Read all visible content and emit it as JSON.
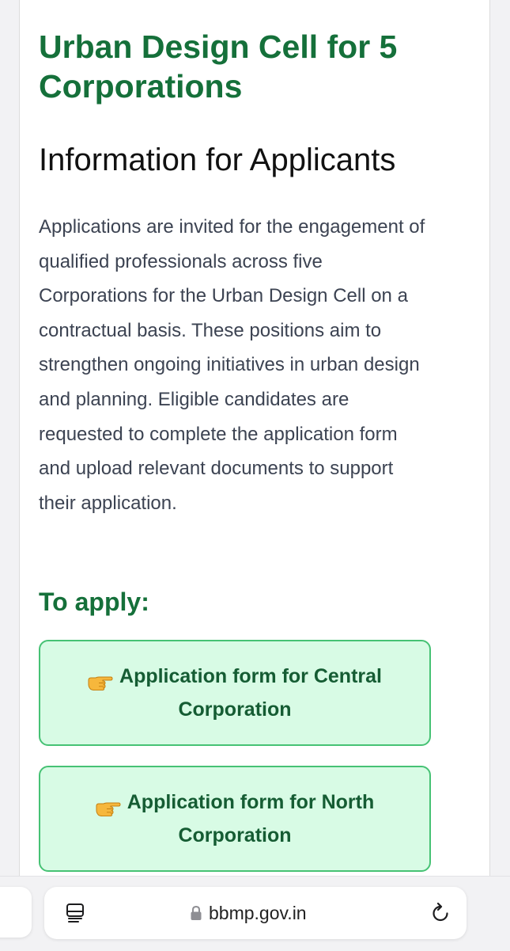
{
  "header": {
    "title": "Urban Design Cell for 5 Corporations",
    "subtitle": "Information for Applicants"
  },
  "main": {
    "description": "Applications are invited for the engagement of qualified professionals across five Corporations for the Urban Design Cell on a contractual basis. These positions aim to strengthen ongoing initiatives in urban design and planning. Eligible candidates are requested to complete the application form and upload relevant documents to support their application.",
    "apply_heading": "To apply:",
    "application_links": [
      {
        "label": "Application form for Central Corporation",
        "icon": "pointing-hand-icon"
      },
      {
        "label": "Application form for North Corporation",
        "icon": "pointing-hand-icon"
      }
    ]
  },
  "browser": {
    "url": "bbmp.gov.in",
    "reader_icon": "reader-mode-icon",
    "lock_icon": "lock-icon",
    "reload_icon": "reload-icon"
  },
  "colors": {
    "heading_green": "#15703a",
    "button_bg": "#d8fbe5",
    "button_border": "#46c274"
  }
}
